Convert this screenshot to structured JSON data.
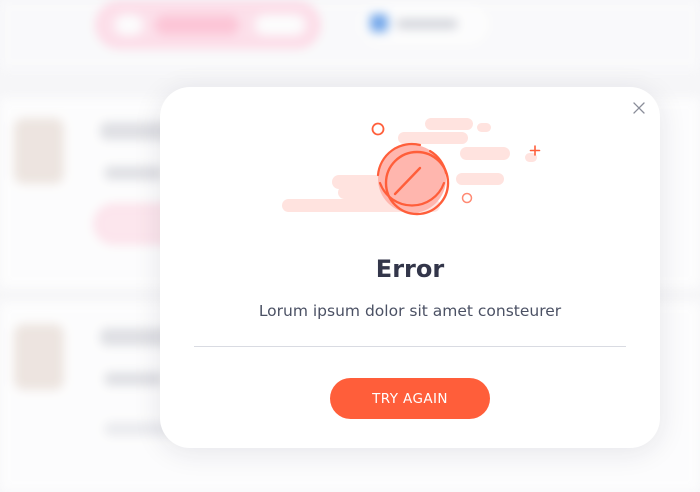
{
  "dialog": {
    "title": "Error",
    "message": "Lorum ipsum dolor sit amet consteurer",
    "button_label": "TRY AGAIN",
    "close_icon": "close-icon",
    "illustration_icon": "error-prohibited-icon"
  },
  "colors": {
    "accent": "#ff5e3a",
    "title": "#33364a",
    "illustration_light": "#ffe3df",
    "illustration_mid": "#ffb6ae"
  }
}
